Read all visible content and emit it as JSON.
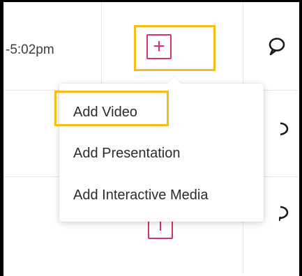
{
  "row": {
    "time_text": "-5:02pm",
    "add_button_symbol": "+"
  },
  "menu": {
    "items": [
      {
        "label": "Add Video"
      },
      {
        "label": "Add Presentation"
      },
      {
        "label": "Add Interactive Media"
      }
    ]
  },
  "icons": {
    "add": "plus-icon",
    "chat": "chat-bubble-icon"
  },
  "colors": {
    "accent": "#d6307a",
    "highlight": "#f6bd16",
    "text": "#2b2b2b"
  }
}
